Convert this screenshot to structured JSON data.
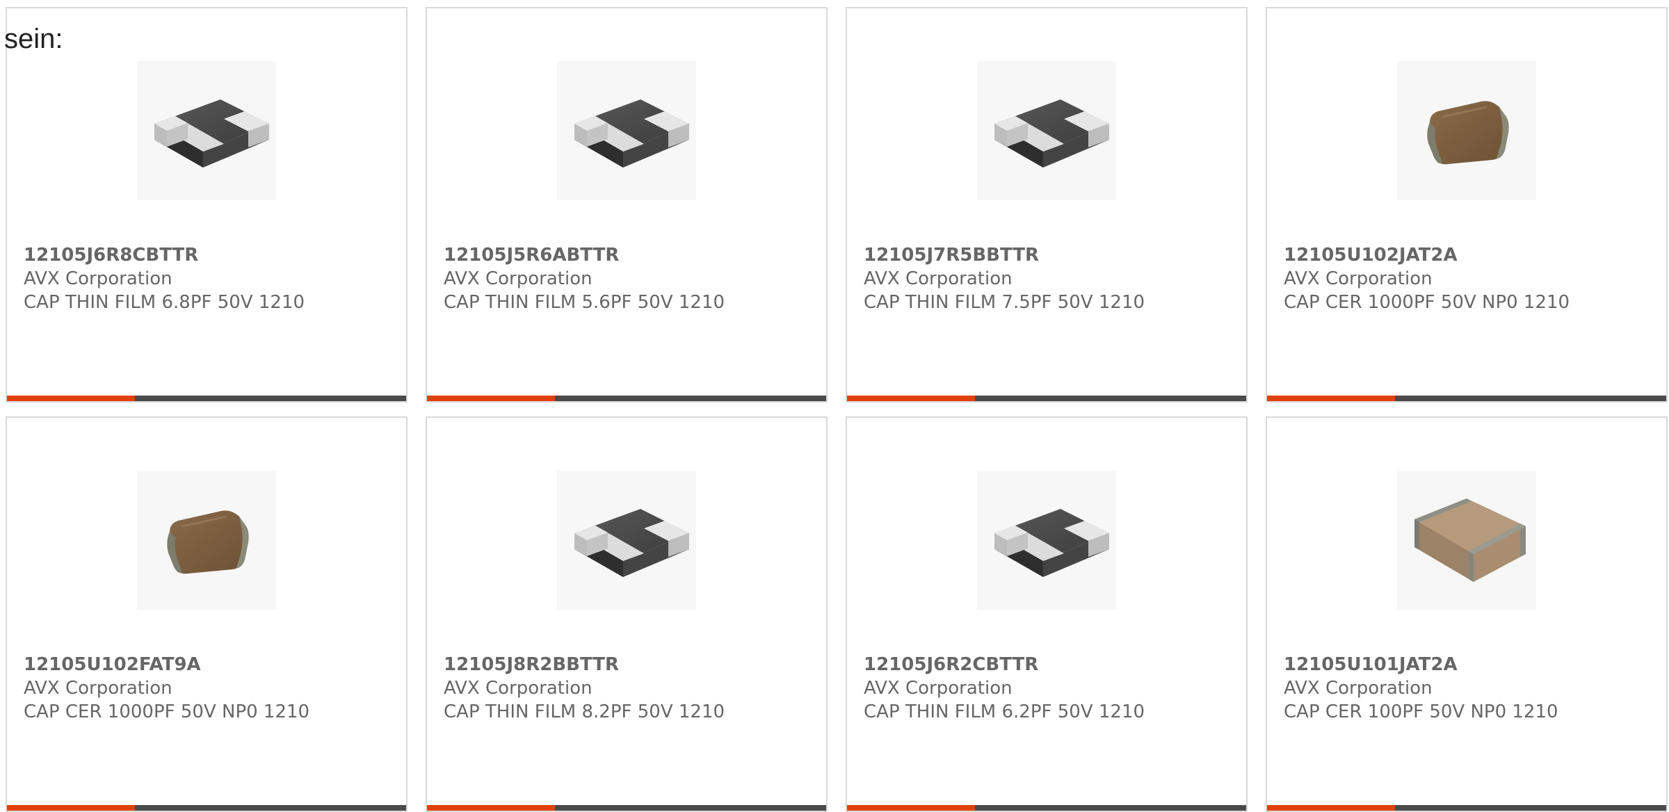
{
  "lead_text": "sein:",
  "colors": {
    "accent": "#e0420a",
    "bar_track": "#4a4a4a",
    "card_border": "#d9d9d9",
    "text": "#666666"
  },
  "products": [
    {
      "part_number": "12105J6R8CBTTR",
      "manufacturer": "AVX Corporation",
      "description": "CAP THIN FILM 6.8PF 50V 1210",
      "image_icon": "thin-film-capacitor-icon",
      "bar_fill": 0.32
    },
    {
      "part_number": "12105J5R6ABTTR",
      "manufacturer": "AVX Corporation",
      "description": "CAP THIN FILM 5.6PF 50V 1210",
      "image_icon": "thin-film-capacitor-icon",
      "bar_fill": 0.32
    },
    {
      "part_number": "12105J7R5BBTTR",
      "manufacturer": "AVX Corporation",
      "description": "CAP THIN FILM 7.5PF 50V 1210",
      "image_icon": "thin-film-capacitor-icon",
      "bar_fill": 0.32
    },
    {
      "part_number": "12105U102JAT2A",
      "manufacturer": "AVX Corporation",
      "description": "CAP CER 1000PF 50V NP0 1210",
      "image_icon": "ceramic-capacitor-icon",
      "bar_fill": 0.32
    },
    {
      "part_number": "12105U102FAT9A",
      "manufacturer": "AVX Corporation",
      "description": "CAP CER 1000PF 50V NP0 1210",
      "image_icon": "ceramic-capacitor-icon",
      "bar_fill": 0.32
    },
    {
      "part_number": "12105J8R2BBTTR",
      "manufacturer": "AVX Corporation",
      "description": "CAP THIN FILM 8.2PF 50V 1210",
      "image_icon": "thin-film-capacitor-icon",
      "bar_fill": 0.32
    },
    {
      "part_number": "12105J6R2CBTTR",
      "manufacturer": "AVX Corporation",
      "description": "CAP THIN FILM 6.2PF 50V 1210",
      "image_icon": "thin-film-capacitor-icon",
      "bar_fill": 0.32
    },
    {
      "part_number": "12105U101JAT2A",
      "manufacturer": "AVX Corporation",
      "description": "CAP CER 100PF 50V NP0 1210",
      "image_icon": "large-ceramic-capacitor-icon",
      "bar_fill": 0.32
    }
  ]
}
